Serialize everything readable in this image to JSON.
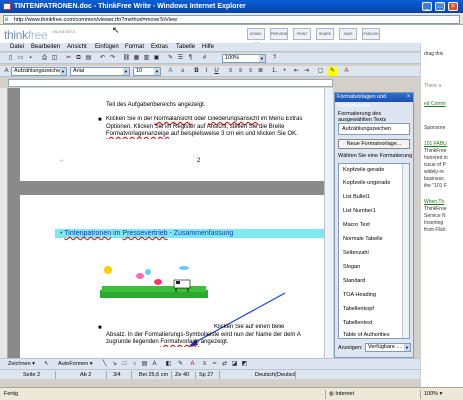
{
  "window": {
    "title": "TINTENPATRONEN.doc - ThinkFree Write - Windows Internet Explorer"
  },
  "address": {
    "url": "http://www.thinkfree.com/common/viewer.tfo?method=moveToView"
  },
  "header": {
    "logo_main": "think",
    "logo_accent": "free",
    "beta": "ONLINE BETA",
    "buttons": [
      "DOWN-LOAD",
      "PREVIEW",
      "PRINT",
      "SHARE",
      "SAVE",
      "PUBLISH"
    ]
  },
  "menubar": [
    "Datei",
    "Bearbeiten",
    "Ansicht",
    "Einfügen",
    "Format",
    "Extras",
    "Tabelle",
    "Hilfe"
  ],
  "toolbar1": {
    "zoom": "100%"
  },
  "toolbar2": {
    "style": "Aufzählungszeichen",
    "font": "Arial",
    "size": "10"
  },
  "document": {
    "line1": "Teil des Aufgabenbereichs angezeigt.",
    "bullet1_a": "Klicken Sie in der",
    "bullet1_link1": "Normalansicht",
    "bullet1_b": "oder",
    "bullet1_link2": "Gliederungsansicht",
    "bullet1_c": "im Menü Extras",
    "bullet1_line2": "Optionen. Klicken Sie im Register auf Ansicht, stellen Sie die Breite",
    "bullet1_line3_link": "Formatvorlagenanzeige",
    "bullet1_line3_b": "auf beispielsweise 3 cm ein und klicken Sie OK.",
    "page_num": "2",
    "heading_word1": "Tintenpatronen",
    "heading_mid": "im",
    "heading_word2": "Pressevertrieb",
    "heading_rest": "- Zusammenfassung",
    "bullet2_line1": "Klicken Sie auf einen belie",
    "bullet2_line2": "Absatz. In der Formatierungs-Symbolleiste wird nun der Name der dem A",
    "bullet2_line3_a": "zugrunde liegenden",
    "bullet2_line3_link": "Formatvorlage",
    "bullet2_line3_b": "angezeigt."
  },
  "panel": {
    "title": "Formatvorlagen und Formatierung",
    "label_selected": "Formatierung des ausgewählten Texts",
    "selected_value": "Aufzählungszeichen",
    "new_style_btn": "Neue Formatvorlage...",
    "label_pick": "Wählen Sie eine Formatierung",
    "styles": [
      "Kopfzeile gerade",
      "Kopfzeile ungerade",
      "List Bullet1",
      "List Number1",
      "Macro Text",
      "Normale Tabelle",
      "Seitenzahl",
      "Slogan",
      "Standard",
      "TOA Heading",
      "Tabellenkopf",
      "Tabellentext",
      "Table of Authorities"
    ],
    "show_label": "Anzeigen:",
    "show_value": "Verfügbare ..."
  },
  "bottom_toolbar": {
    "draw": "Zeichnen",
    "autoforms": "AutoFormen"
  },
  "word_status": [
    "Seite 2",
    "Ab 2",
    "3/4",
    "Bei 25,6 cm",
    "Ze 40",
    "Sp 27",
    "Deutsch(Deutschland)"
  ],
  "ie_status": {
    "left": "Fertig",
    "zone": "Internet",
    "zoom": "100%"
  },
  "right_pane": {
    "line1": "drag this",
    "line2": "There a",
    "line3": "ed Comm",
    "line4": "Sponsore",
    "line5": "101 FABU",
    "line6": "ThinkFree",
    "line7": "honored in",
    "line8": "issue of P",
    "line9": "widely-re",
    "line10": "business",
    "line11": "the \"101 F",
    "line12": "When Th",
    "line13": "ThinkFree",
    "line14": "Service N",
    "line15": "Inserting",
    "line16": "from Flick"
  },
  "colors": {
    "title_blue": "#0842a8",
    "heading_cyan": "#7ee8f0",
    "heading_text": "#1040c0",
    "link_green": "#1a7a1a"
  }
}
